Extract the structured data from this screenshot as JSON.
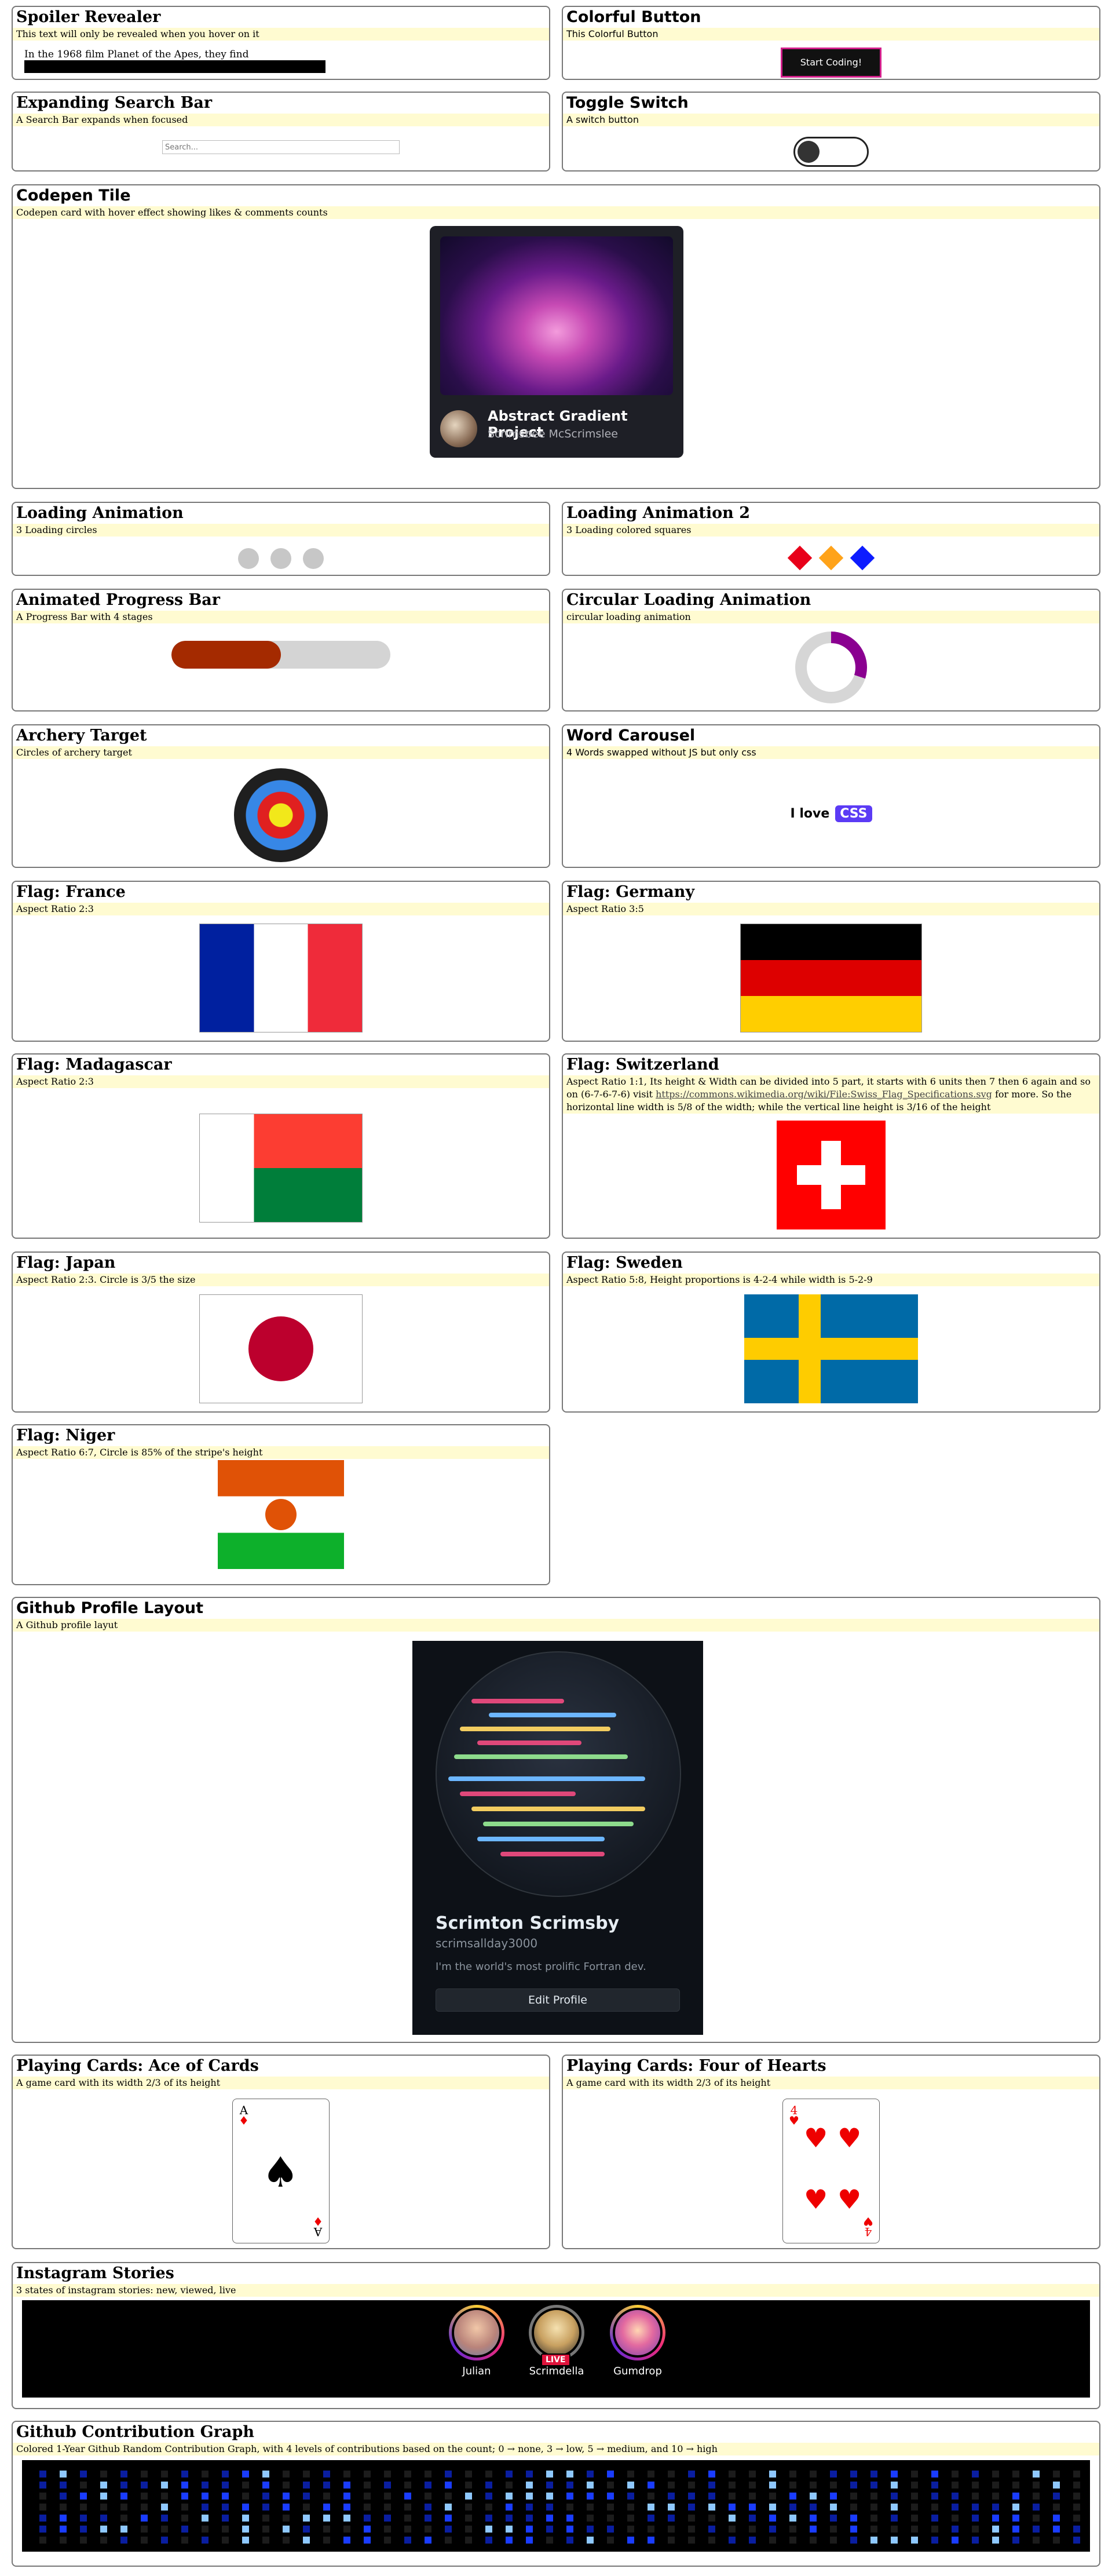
{
  "spoiler": {
    "title": "Spoiler Revealer",
    "desc": "This text will only be revealed when you hover on it",
    "text": "In the 1968 film Planet of the Apes, they find"
  },
  "colorful": {
    "title": "Colorful Button",
    "desc": "This Colorful Button",
    "button": "Start Coding!"
  },
  "search": {
    "title": "Expanding Search Bar",
    "desc": "A Search Bar expands when focused",
    "placeholder": "Search..."
  },
  "toggle": {
    "title": "Toggle Switch",
    "desc": "A switch button"
  },
  "codepen": {
    "title": "Codepen Tile",
    "desc": "Codepen card with hover effect showing likes & comments counts",
    "project": "Abstract Gradient Project",
    "author": "Scrimsbee McScrimslee"
  },
  "loading1": {
    "title": "Loading Animation",
    "desc": "3 Loading circles"
  },
  "loading2": {
    "title": "Loading Animation 2",
    "desc": "3 Loading colored squares",
    "colors": [
      "#e8001a",
      "#ffa31a",
      "#0d1cff"
    ]
  },
  "progress": {
    "title": "Animated Progress Bar",
    "desc": "A Progress Bar with 4 stages",
    "value": 0.5
  },
  "circular": {
    "title": "Circular Loading Animation",
    "desc": "circular loading animation",
    "value": 0.3
  },
  "archery": {
    "title": "Archery Target",
    "desc": "Circles of archery target"
  },
  "carousel": {
    "title": "Word Carousel",
    "desc": "4 Words swapped without JS but only css",
    "prefix": "I love",
    "word": "CSS"
  },
  "france": {
    "title": "Flag: France",
    "desc": "Aspect Ratio 2:3"
  },
  "germany": {
    "title": "Flag: Germany",
    "desc": "Aspect Ratio 3:5"
  },
  "madagascar": {
    "title": "Flag: Madagascar",
    "desc": "Aspect Ratio 2:3"
  },
  "switzerland": {
    "title": "Flag: Switzerland",
    "desc_a": "Aspect Ratio 1:1, Its height & Width can be divided into 5 part, it starts with 6 units then 7 then 6 again and so on (6-7-6-7-6) visit ",
    "link": "https://commons.wikimedia.org/wiki/File:Swiss_Flag_Specifications.svg",
    "desc_b": " for more. So the horizontal line width is 5/8 of the width; while the vertical line height is 3/16 of the height"
  },
  "japan": {
    "title": "Flag: Japan",
    "desc": "Aspect Ratio 2:3. Circle is 3/5 the size"
  },
  "sweden": {
    "title": "Flag: Sweden",
    "desc": "Aspect Ratio 5:8, Height proportions is 4-2-4 while width is 5-2-9"
  },
  "niger": {
    "title": "Flag: Niger",
    "desc": "Aspect Ratio 6:7, Circle is 85% of the stripe's height"
  },
  "github": {
    "title": "Github Profile Layout",
    "desc": "A Github profile layut",
    "name": "Scrimton Scrimsby",
    "username": "scrimsallday3000",
    "bio": "I'm the world's most prolific Fortran dev.",
    "button": "Edit Profile"
  },
  "ace": {
    "title": "Playing Cards: Ace of Cards",
    "desc": "A game card with its width 2/3 of its height",
    "rank": "A",
    "suit": "♠",
    "small_suit": "♦"
  },
  "four": {
    "title": "Playing Cards: Four of Hearts",
    "desc": "A game card with its width 2/3 of its height",
    "rank": "4",
    "suit": "♥"
  },
  "instagram": {
    "title": "Instagram Stories",
    "desc": "3 states of instagram stories: new, viewed, live",
    "stories": [
      {
        "name": "Julian"
      },
      {
        "name": "Scrimdella",
        "live": "LIVE"
      },
      {
        "name": "Gumdrop"
      }
    ]
  },
  "contribution": {
    "title": "Github Contribution Graph",
    "desc": "Colored 1-Year Github Random Contribution Graph, with 4 levels of contributions based on the count; 0 → none, 3 → low, 5 → medium, and 10 → high"
  }
}
